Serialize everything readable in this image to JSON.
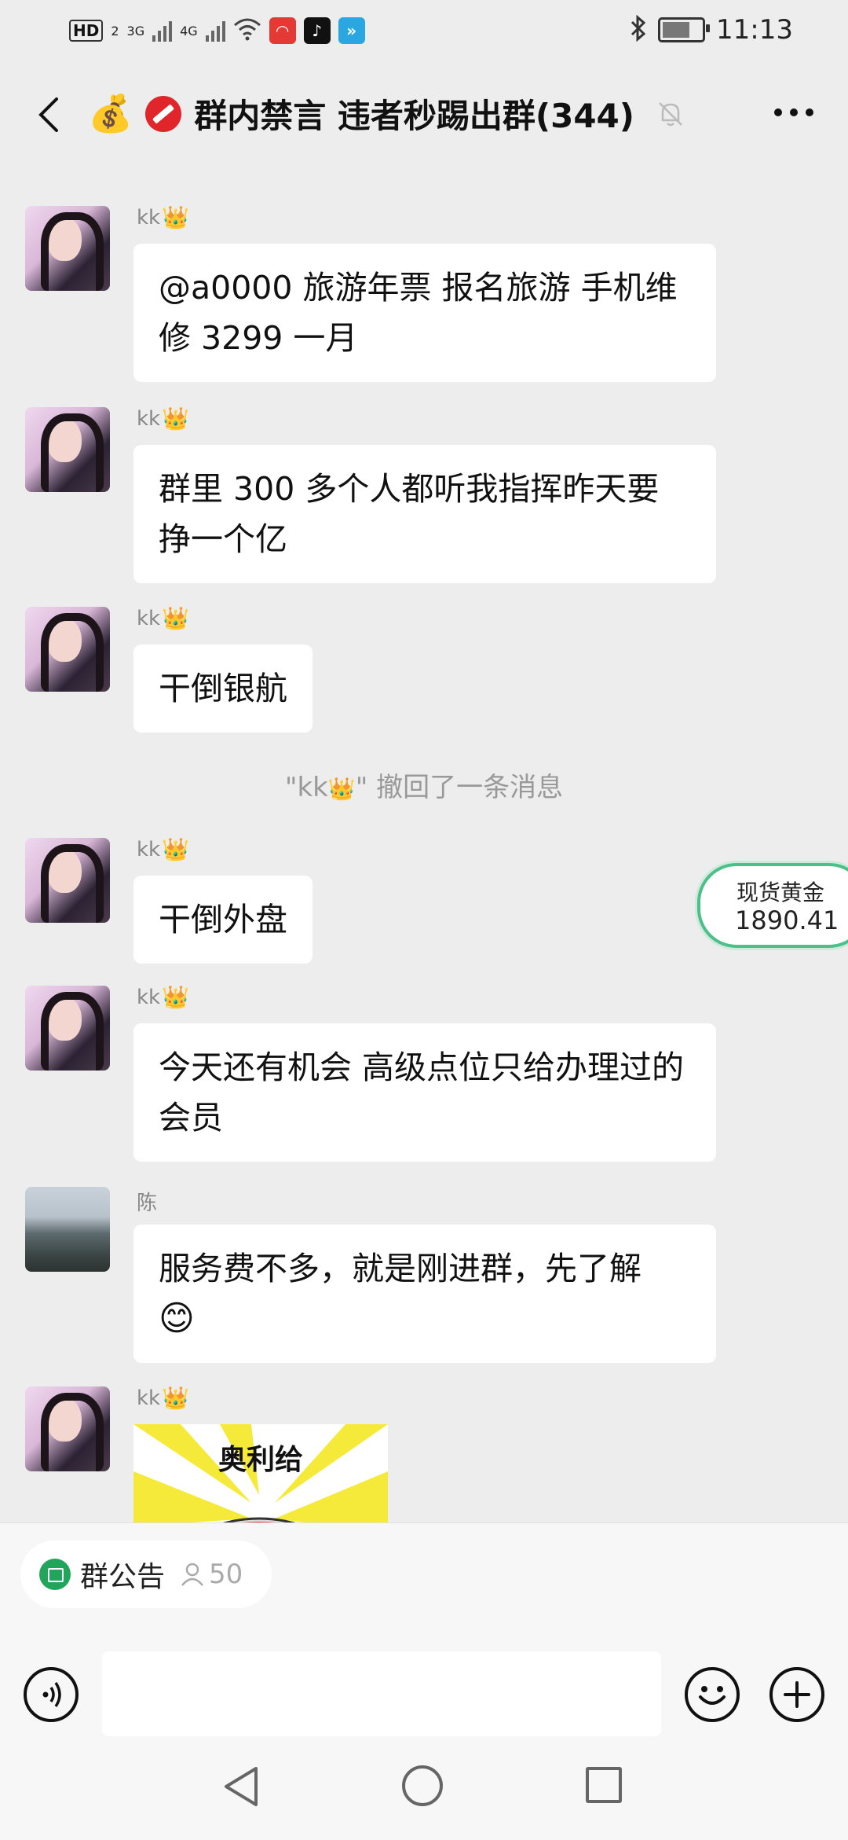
{
  "status_bar": {
    "hd": "HD",
    "hd_sub": "2",
    "net1": "3G",
    "net2": "4G",
    "time": "11:13"
  },
  "header": {
    "title": "群内禁言 违者秒踢出群(344)"
  },
  "messages": [
    {
      "sender": "kk",
      "text": "@a0000 旅游年票 报名旅游 手机维修 3299 一月"
    },
    {
      "sender": "kk",
      "text": "群里 300 多个人都听我指挥昨天要挣一个亿"
    },
    {
      "sender": "kk",
      "text": "干倒银航"
    },
    {
      "system_prefix": "\"kk",
      "system_suffix": "\" 撤回了一条消息"
    },
    {
      "sender": "kk",
      "text": "干倒外盘"
    },
    {
      "sender": "kk",
      "text": "今天还有机会 高级点位只给办理过的会员"
    },
    {
      "sender": "陈",
      "text": "服务费不多，就是刚进群，先了解"
    },
    {
      "sender": "kk",
      "sticker_text": "奥利给"
    }
  ],
  "gold_widget": {
    "label": "现货黄金",
    "price": "1890.41"
  },
  "notice": {
    "label": "群公告",
    "count": "50"
  },
  "colors": {
    "background": "#ededed",
    "bubble": "#ffffff",
    "accent_green": "#21a55b"
  }
}
